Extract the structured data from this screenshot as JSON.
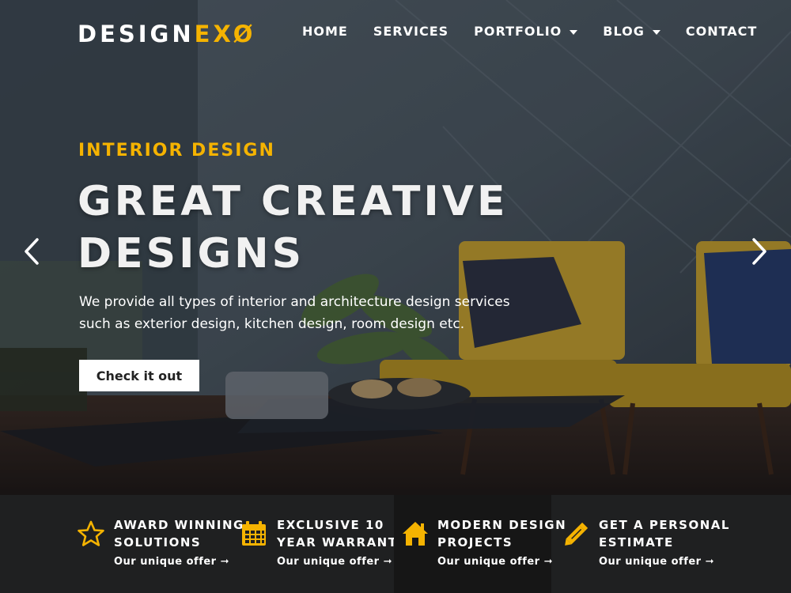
{
  "brand": {
    "logo_main": "DESIGN",
    "logo_accent": "EXØ",
    "accent_color": "#f5b301"
  },
  "nav": {
    "items": [
      {
        "label": "HOME"
      },
      {
        "label": "SERVICES"
      },
      {
        "label": "PORTFOLIO"
      },
      {
        "label": "BLOG"
      },
      {
        "label": "CONTACT"
      }
    ]
  },
  "hero": {
    "eyebrow": "INTERIOR DESIGN",
    "title_line1": "GREAT CREATIVE",
    "title_line2": "DESIGNS",
    "description_line1": "We provide all types of interior and architecture design services",
    "description_line2": "such as exterior design, kitchen design, room design etc.",
    "button_label": "Check it out",
    "prev_icon": "chevron-left-icon",
    "next_icon": "chevron-right-icon"
  },
  "features": [
    {
      "icon": "star-icon",
      "title_line1": "AWARD WINNING",
      "title_line2": "SOLUTIONS",
      "link": "Our unique offer ➞"
    },
    {
      "icon": "calendar-icon",
      "title_line1": "EXCLUSIVE 10",
      "title_line2": "YEAR WARRANTY",
      "link": "Our unique offer ➞"
    },
    {
      "icon": "home-icon",
      "title_line1": "MODERN DESIGN",
      "title_line2": "PROJECTS",
      "link": "Our unique offer ➞"
    },
    {
      "icon": "pencil-icon",
      "title_line1": "GET A PERSONAL",
      "title_line2": "ESTIMATE",
      "link": "Our unique offer ➞"
    }
  ]
}
